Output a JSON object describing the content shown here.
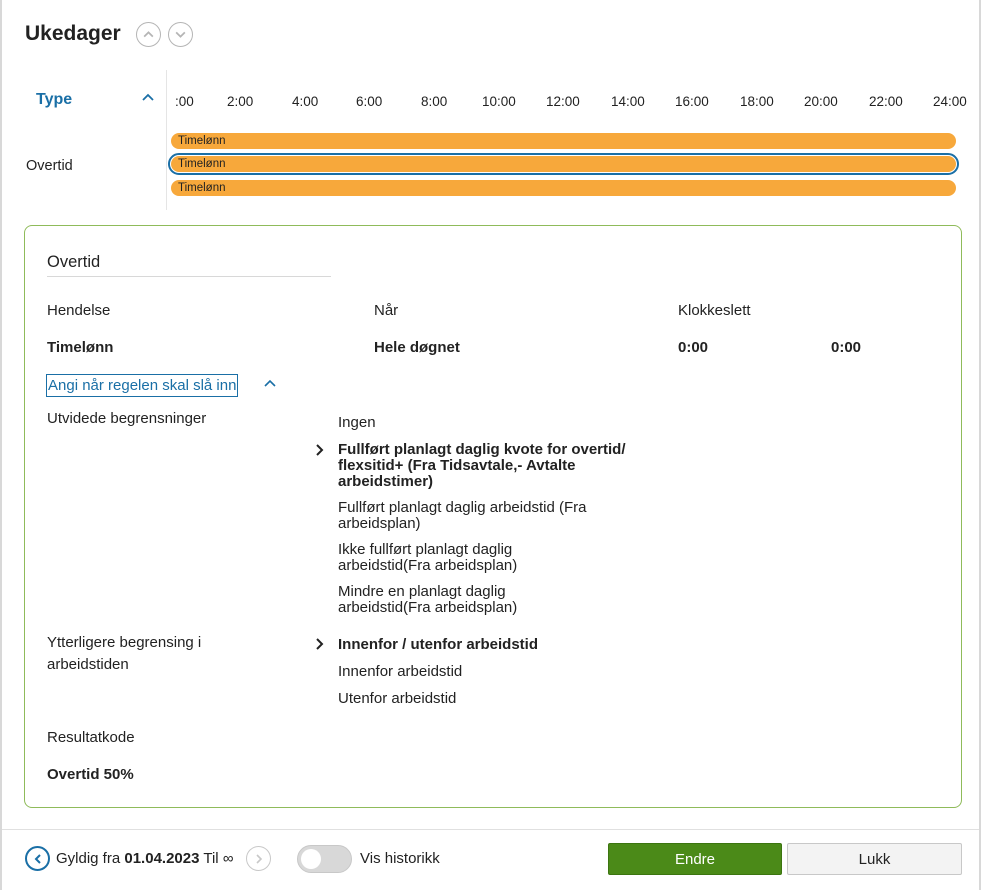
{
  "header": {
    "title": "Ukedager",
    "prev_icon": "chevron-up-icon",
    "next_icon": "chevron-down-icon"
  },
  "timeline": {
    "type_label": "Type",
    "hours": [
      ":00",
      "2:00",
      "4:00",
      "6:00",
      "8:00",
      "10:00",
      "12:00",
      "14:00",
      "16:00",
      "18:00",
      "20:00",
      "22:00",
      "24:00"
    ],
    "row_label": "Overtid",
    "bars": [
      {
        "label": "Timelønn",
        "selected": false
      },
      {
        "label": "Timelønn",
        "selected": true
      },
      {
        "label": "Timelønn",
        "selected": false
      }
    ],
    "bar_color": "#f7a83b",
    "selected_color": "#1a6fa6"
  },
  "details": {
    "title": "Overtid",
    "columns": {
      "hendelse": "Hendelse",
      "naar": "Når",
      "klokkeslett": "Klokkeslett"
    },
    "values": {
      "hendelse": "Timelønn",
      "naar": "Hele døgnet",
      "from": "0:00",
      "to": "0:00"
    },
    "angi_link": "Angi når regelen skal slå inn",
    "utvidede": {
      "label": "Utvidede begrensninger",
      "options": [
        "Ingen",
        "Fullført planlagt daglig kvote for overtid/ flexsitid+ (Fra Tidsavtale,- Avtalte arbeidstimer)",
        "Fullført planlagt daglig arbeidstid (Fra arbeidsplan)",
        "Ikke fullført planlagt daglig arbeidstid(Fra arbeidsplan)",
        "Mindre en planlagt daglig arbeidstid(Fra arbeidsplan)"
      ],
      "selected_index": 1
    },
    "ytterligere": {
      "label": "Ytterligere begrensing i arbeidstiden",
      "options": [
        "Innenfor / utenfor arbeidstid",
        "Innenfor arbeidstid",
        "Utenfor arbeidstid"
      ],
      "selected_index": 0
    },
    "resultatkode": {
      "label": "Resultatkode",
      "value": "Overtid 50%"
    },
    "border_color": "#8fbb5a"
  },
  "footer": {
    "gyldig_prefix": "Gyldig fra",
    "gyldig_date": "01.04.2023",
    "til_label": "Til",
    "til_value": "∞",
    "historikk_label": "Vis historikk",
    "historikk_on": false,
    "endre_label": "Endre",
    "lukk_label": "Lukk",
    "endre_color": "#4b8a18"
  }
}
